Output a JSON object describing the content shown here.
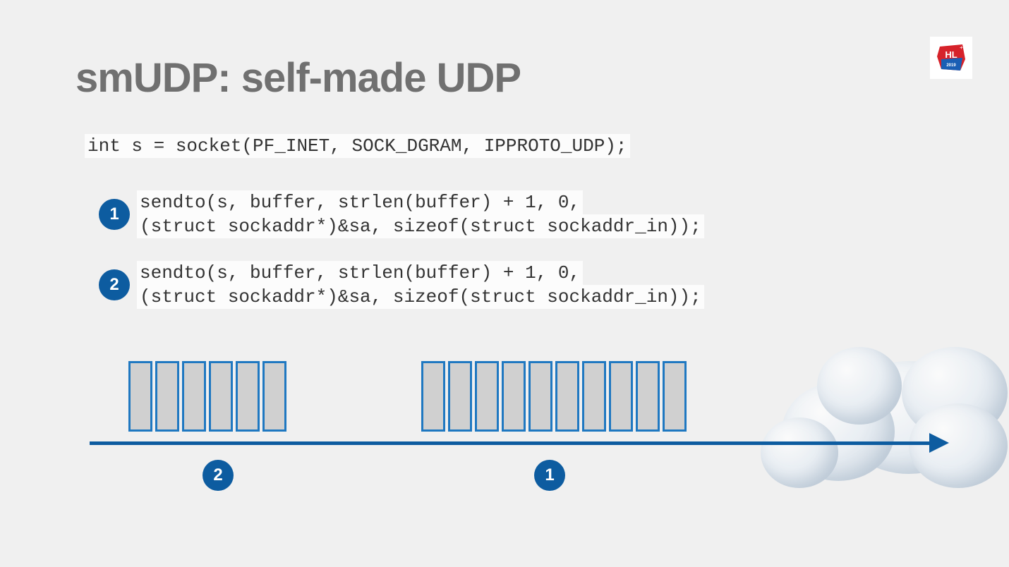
{
  "title": "smUDP: self-made UDP",
  "logo": {
    "text": "HL",
    "subtext": "2019"
  },
  "code": {
    "socket": "int s = socket(PF_INET, SOCK_DGRAM, IPPROTO_UDP);",
    "sendto_line1": "sendto(s, buffer, strlen(buffer) + 1, 0,",
    "sendto_line2": "(struct sockaddr*)&sa, sizeof(struct sockaddr_in));"
  },
  "bullets": {
    "first": "1",
    "second": "2"
  },
  "diagram": {
    "label_left": "2",
    "label_right": "1",
    "group_a_packets": 6,
    "group_b_packets": 10
  },
  "colors": {
    "accent": "#0d5ca0",
    "packet_border": "#1f78c1",
    "title": "#707070"
  }
}
